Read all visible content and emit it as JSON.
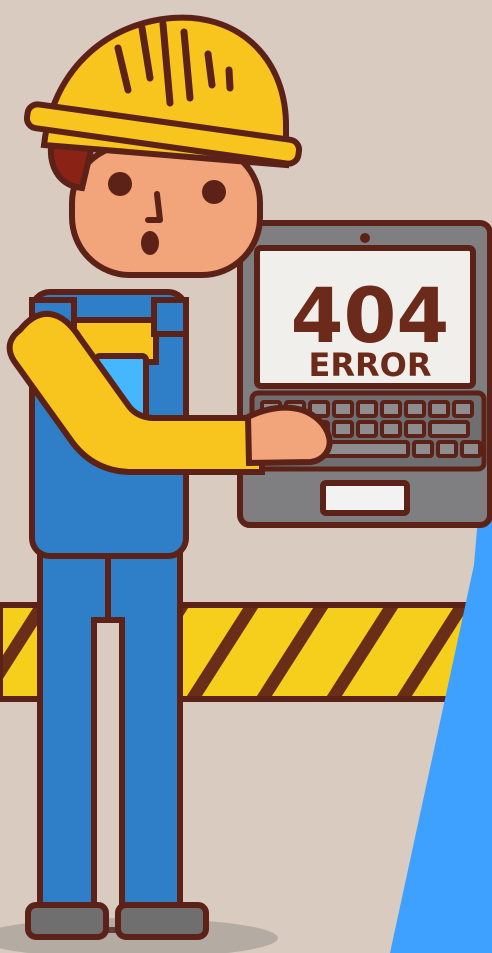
{
  "screen": {
    "code": "404",
    "label": "ERROR"
  },
  "colors": {
    "background": "#d9cbbf",
    "outline": "#5c2217",
    "helmet": "#f7c51e",
    "overalls": "#2f7fc8",
    "shirt": "#f7c51e",
    "skin": "#f2a47a",
    "stripe_yellow": "#f6cf1c",
    "stripe_brown": "#6a2d17",
    "laptop": "#7f7f82",
    "screen_bg": "#f1efeb",
    "blue_panel": "#3ea0ff"
  },
  "icons": [
    "construction-worker-illustration",
    "hard-hat-icon",
    "laptop-icon",
    "caution-tape-icon"
  ]
}
